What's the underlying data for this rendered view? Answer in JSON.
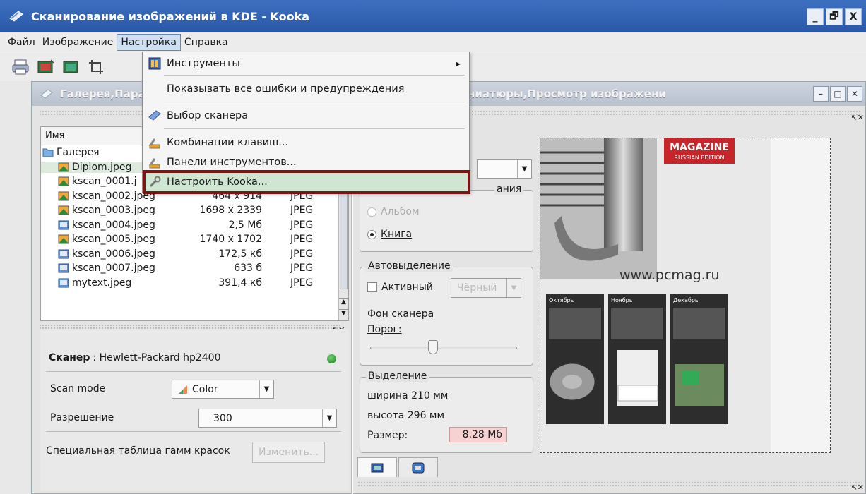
{
  "window": {
    "title": "Сканирование изображений в KDE - Kooka",
    "buttons": [
      "_",
      "🗗",
      "X"
    ]
  },
  "menubar": {
    "items": [
      "Файл",
      "Изображение",
      "Настройка",
      "Справка"
    ],
    "open_item": "Настройка"
  },
  "settings_menu": {
    "items": [
      {
        "label": "Инструменты",
        "icon": "tools-icon",
        "submenu": true
      },
      {
        "label": "Показывать все ошибки и предупреждения",
        "icon": ""
      },
      {
        "label": "Выбор сканера",
        "icon": "scanner-select-icon"
      },
      {
        "label": "Комбинации клавиш...",
        "icon": "keyboard-icon"
      },
      {
        "label": "Панели инструментов...",
        "icon": "toolbar-config-icon"
      },
      {
        "label": "Настроить Kooka...",
        "icon": "configure-icon",
        "highlighted": true
      }
    ],
    "submenu_arrow": "▸"
  },
  "inner_window": {
    "title": "Галерея,Параметры сканирования,Загруженное изображение,Миниатюры,Просмотр изображени",
    "title_visible_left": "Галерея,Пар",
    "title_visible_right": "е изображение,Миниатюры,Просмотр изображени"
  },
  "gallery": {
    "header": "Имя",
    "root": "Галерея",
    "files": [
      {
        "name": "Diplom.jpeg",
        "dims": "",
        "type": "",
        "icon": "image-icon",
        "selected": true
      },
      {
        "name": "kscan_0001.j",
        "dims": "",
        "type": "",
        "icon": "image-icon"
      },
      {
        "name": "kscan_0002.jpeg",
        "dims": "464 x 914",
        "type": "JPEG",
        "icon": "image-icon"
      },
      {
        "name": "kscan_0003.jpeg",
        "dims": "1698 x 2339",
        "type": "JPEG",
        "icon": "image-icon"
      },
      {
        "name": "kscan_0004.jpeg",
        "dims": "2,5 Мб",
        "type": "JPEG",
        "icon": "file-icon"
      },
      {
        "name": "kscan_0005.jpeg",
        "dims": "1740 x 1702",
        "type": "JPEG",
        "icon": "image-icon"
      },
      {
        "name": "kscan_0006.jpeg",
        "dims": "172,5 кб",
        "type": "JPEG",
        "icon": "file-icon"
      },
      {
        "name": "kscan_0007.jpeg",
        "dims": "633 б",
        "type": "JPEG",
        "icon": "file-icon"
      },
      {
        "name": "mytext.jpeg",
        "dims": "391,4 кб",
        "type": "JPEG",
        "icon": "file-icon"
      }
    ]
  },
  "scanner": {
    "label": "Сканер",
    "name": ": Hewlett-Packard hp2400",
    "scan_mode_label": "Scan mode",
    "scan_mode_value": "Color",
    "resolution_label": "Разрешение",
    "resolution_value": "300",
    "gamma_label": "Специальная таблица гамм красок",
    "gamma_button": "Изменить..."
  },
  "options": {
    "mode_group_title": "ания",
    "radio_album": "Альбом",
    "radio_book": "Книга",
    "auto_group_title": "Автовыделение",
    "active_label": "Активный",
    "active_combo": "Чёрный",
    "background_label": "Фон сканера",
    "threshold_label": "Порог:",
    "selection_title": "Выделение",
    "width_text": "ширина 210 мм",
    "height_text": "высота 296 мм",
    "size_label": "Размер:",
    "size_value": "8.28 Мб"
  },
  "preview": {
    "magazine_title": "MAGAZINE",
    "magazine_sub": "RUSSIAN EDITION",
    "site": "www.pcmag.ru",
    "months": [
      "Октябрь",
      "Ноябрь",
      "Декабрь"
    ]
  },
  "colors": {
    "titlebar": "#2f5fb3",
    "highlight_border": "#7a1515",
    "menu_highlight": "#cfe6d2",
    "size_field": "#f6d2d2"
  }
}
